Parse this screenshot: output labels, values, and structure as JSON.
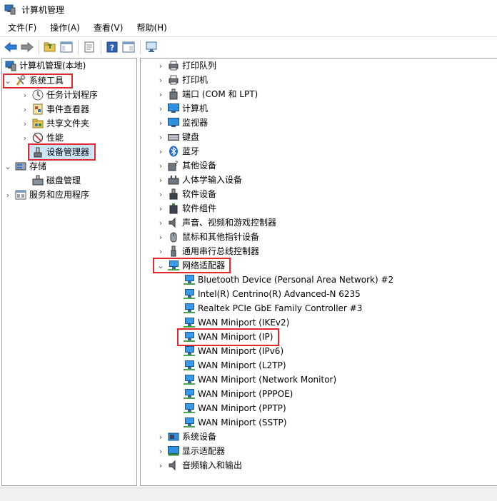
{
  "window": {
    "title": "计算机管理"
  },
  "menu": [
    "文件(F)",
    "操作(A)",
    "查看(V)",
    "帮助(H)"
  ],
  "toolbar": [
    "back-icon",
    "forward-icon",
    "up-folder-icon",
    "show-tree-icon",
    "properties-icon",
    "help-icon",
    "console-tree-icon",
    "monitor-icon"
  ],
  "left_tree": {
    "root": "计算机管理(本地)",
    "system_tools": "系统工具",
    "task_scheduler": "任务计划程序",
    "event_viewer": "事件查看器",
    "shared_folders": "共享文件夹",
    "performance": "性能",
    "device_manager": "设备管理器",
    "storage": "存储",
    "disk_management": "磁盘管理",
    "services_apps": "服务和应用程序"
  },
  "devices": {
    "categories_top": [
      "打印队列",
      "打印机",
      "端口 (COM 和 LPT)",
      "计算机",
      "监视器",
      "键盘",
      "蓝牙",
      "其他设备",
      "人体学输入设备",
      "软件设备",
      "软件组件",
      "声音、视频和游戏控制器",
      "鼠标和其他指针设备",
      "通用串行总线控制器"
    ],
    "network_adapters": "网络适配器",
    "adapters": [
      "Bluetooth Device (Personal Area Network) #2",
      "Intel(R) Centrino(R) Advanced-N 6235",
      "Realtek PCIe GbE Family Controller #3",
      "WAN Miniport (IKEv2)",
      "WAN Miniport (IP)",
      "WAN Miniport (IPv6)",
      "WAN Miniport (L2TP)",
      "WAN Miniport (Network Monitor)",
      "WAN Miniport (PPPOE)",
      "WAN Miniport (PPTP)",
      "WAN Miniport (SSTP)"
    ],
    "categories_bottom": [
      "系统设备",
      "显示适配器",
      "音频输入和输出"
    ]
  },
  "colors": {
    "highlight": "#e0282e",
    "accent": "#1e7fd6"
  }
}
